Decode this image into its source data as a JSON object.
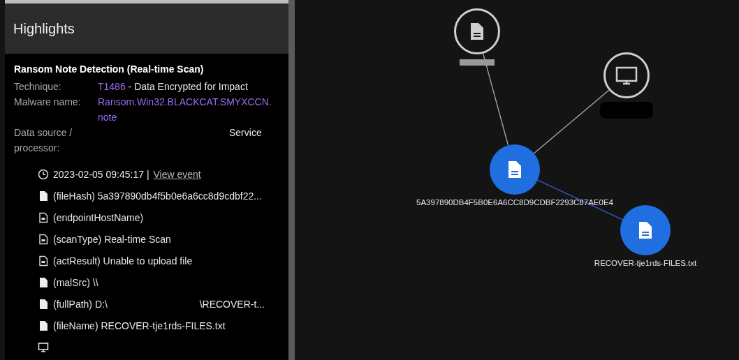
{
  "panel": {
    "title": "Highlights",
    "detection_title": "Ransom Note Detection (Real-time Scan)",
    "fields": [
      {
        "label": "Technique:",
        "link": "T1486",
        "value": " - Data Encrypted for Impact"
      },
      {
        "label": "Malware name:",
        "link": "Ransom.Win32.BLACKCAT.SMYXCCN.note"
      },
      {
        "label": "Data source / processor:",
        "value": "Service"
      }
    ],
    "timestamp": "2023-02-05 09:45:17 |",
    "view_event": "View event",
    "events": [
      {
        "kind": "file-solid",
        "text": "(fileHash) 5a397890db4f5b0e6a6cc8d9cdbf22..."
      },
      {
        "kind": "file-outline",
        "text": "(endpointHostName)"
      },
      {
        "kind": "file-outline",
        "text": "(scanType) Real-time Scan"
      },
      {
        "kind": "file-outline",
        "text": "(actResult) Unable to upload file"
      },
      {
        "kind": "file-solid",
        "text": "(malSrc) \\\\"
      },
      {
        "kind": "file-solid",
        "text": "(fullPath) D:\\",
        "tail": "\\RECOVER-t..."
      },
      {
        "kind": "file-solid",
        "text": "(fileName) RECOVER-tje1rds-FILES.txt"
      },
      {
        "kind": "monitor"
      }
    ]
  },
  "graph": {
    "nodes": [
      {
        "kind": "file",
        "highlighted": false,
        "redacted": true
      },
      {
        "kind": "monitor",
        "highlighted": false,
        "redacted": true
      },
      {
        "kind": "file",
        "highlighted": true,
        "label": "5A397890DB4F5B0E6A6CC8D9CDBF2293C87AE0E4"
      },
      {
        "kind": "file",
        "highlighted": true,
        "label": "RECOVER-tje1rds-FILES.txt"
      }
    ],
    "edges": [
      {
        "highlighted": false
      },
      {
        "highlighted": false
      },
      {
        "highlighted": true
      }
    ]
  }
}
